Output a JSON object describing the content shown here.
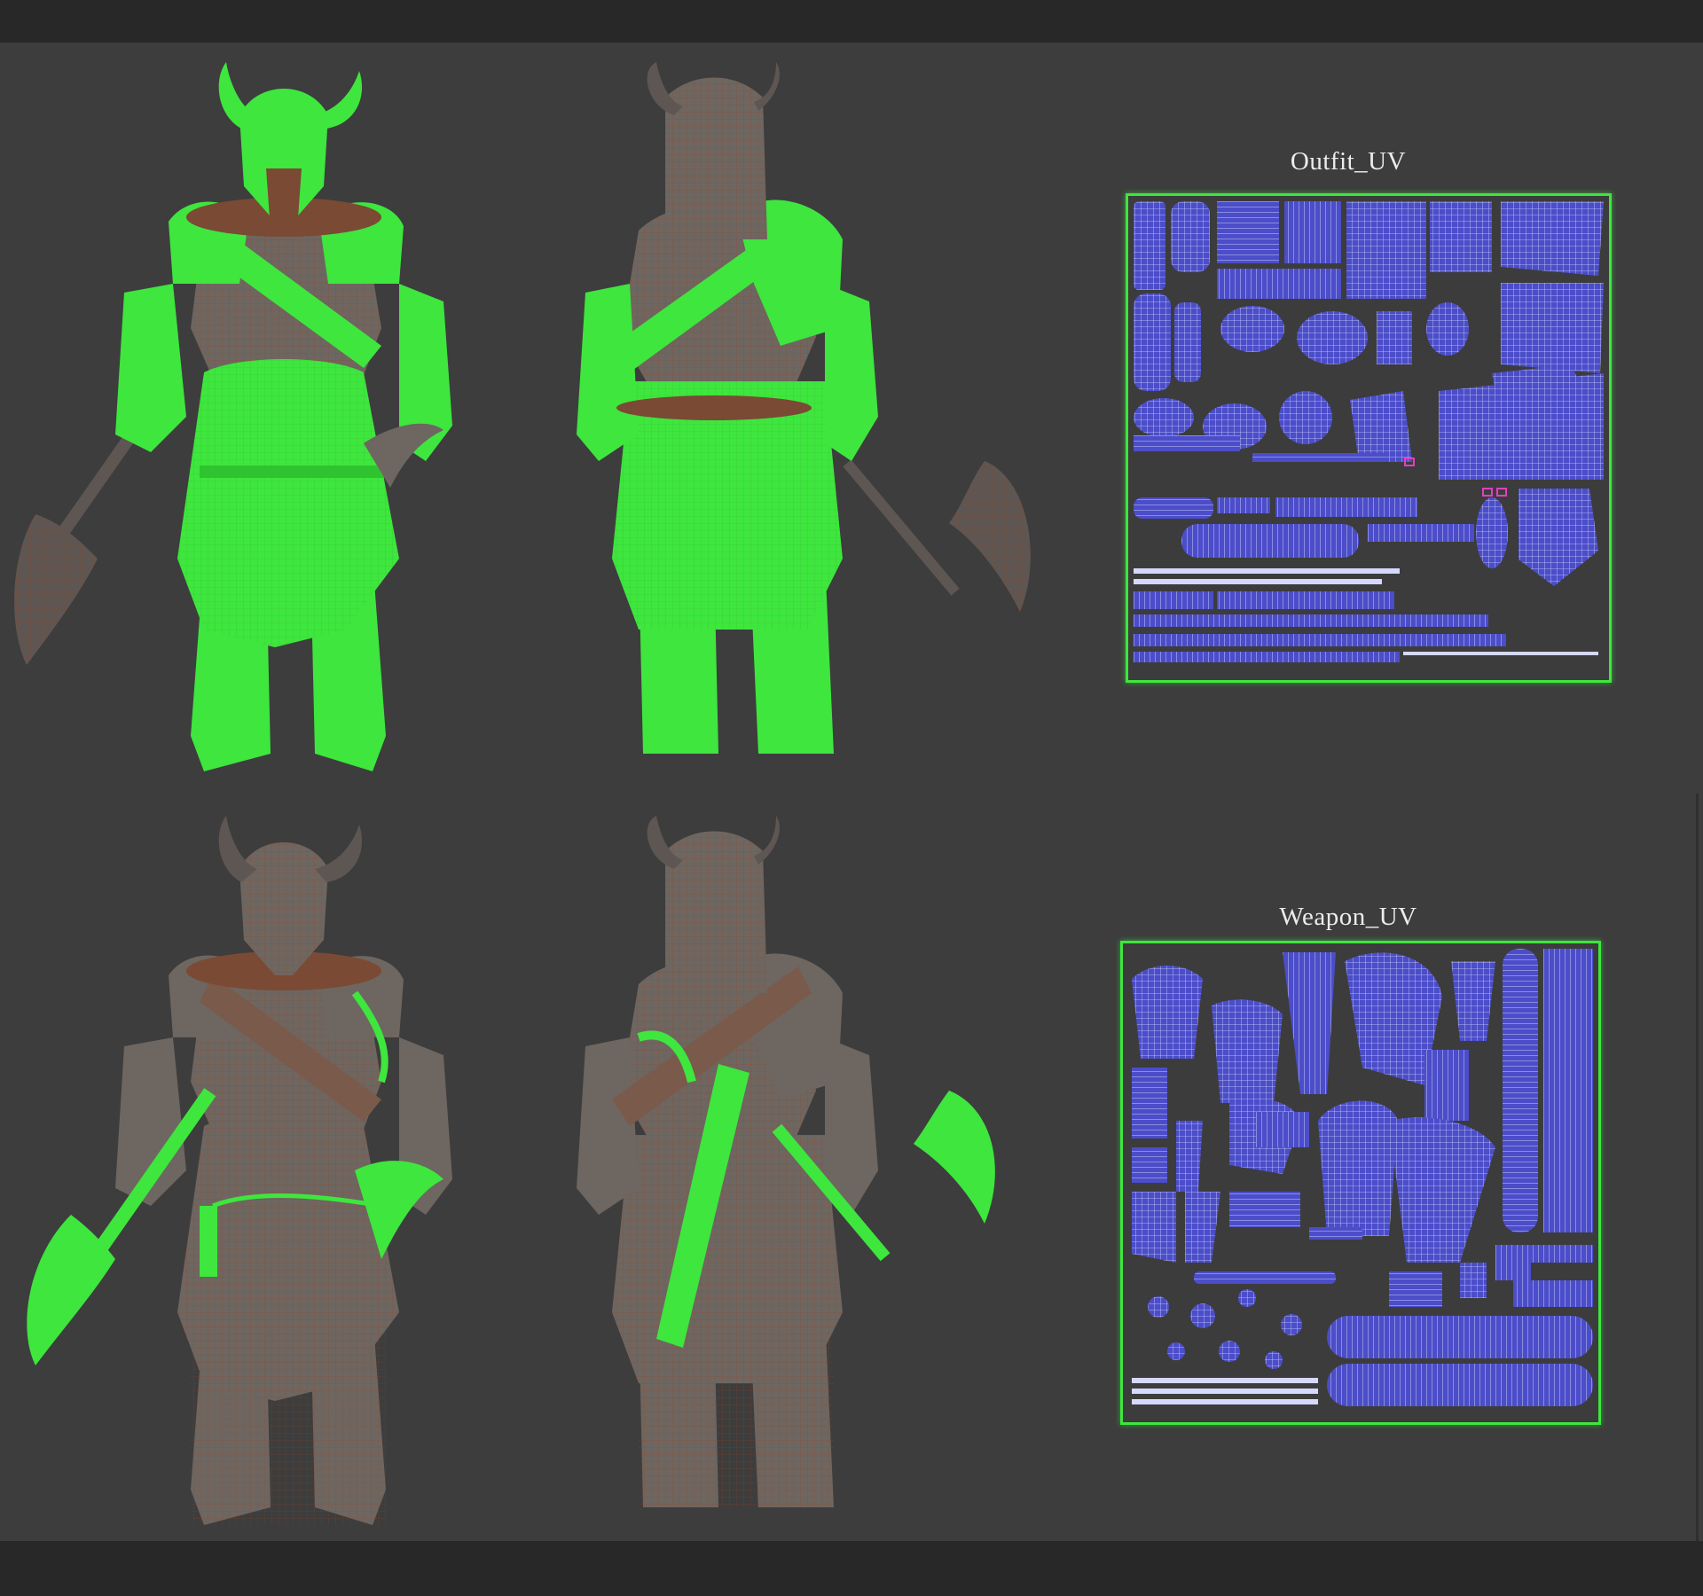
{
  "uv_maps": {
    "outfit": {
      "title": "Outfit_UV"
    },
    "weapon": {
      "title": "Weapon_UV"
    }
  },
  "colors": {
    "background": "#3d3d3d",
    "highlight_green": "#3ee63e",
    "mesh_gray": "#6e6660",
    "wire_orange": "#b2502a",
    "uv_blue": "#4b4dc9"
  },
  "views": [
    {
      "row": "top",
      "angle": "front",
      "highlight": "outfit"
    },
    {
      "row": "top",
      "angle": "back",
      "highlight": "outfit"
    },
    {
      "row": "bottom",
      "angle": "front",
      "highlight": "weapon"
    },
    {
      "row": "bottom",
      "angle": "back",
      "highlight": "weapon"
    }
  ]
}
